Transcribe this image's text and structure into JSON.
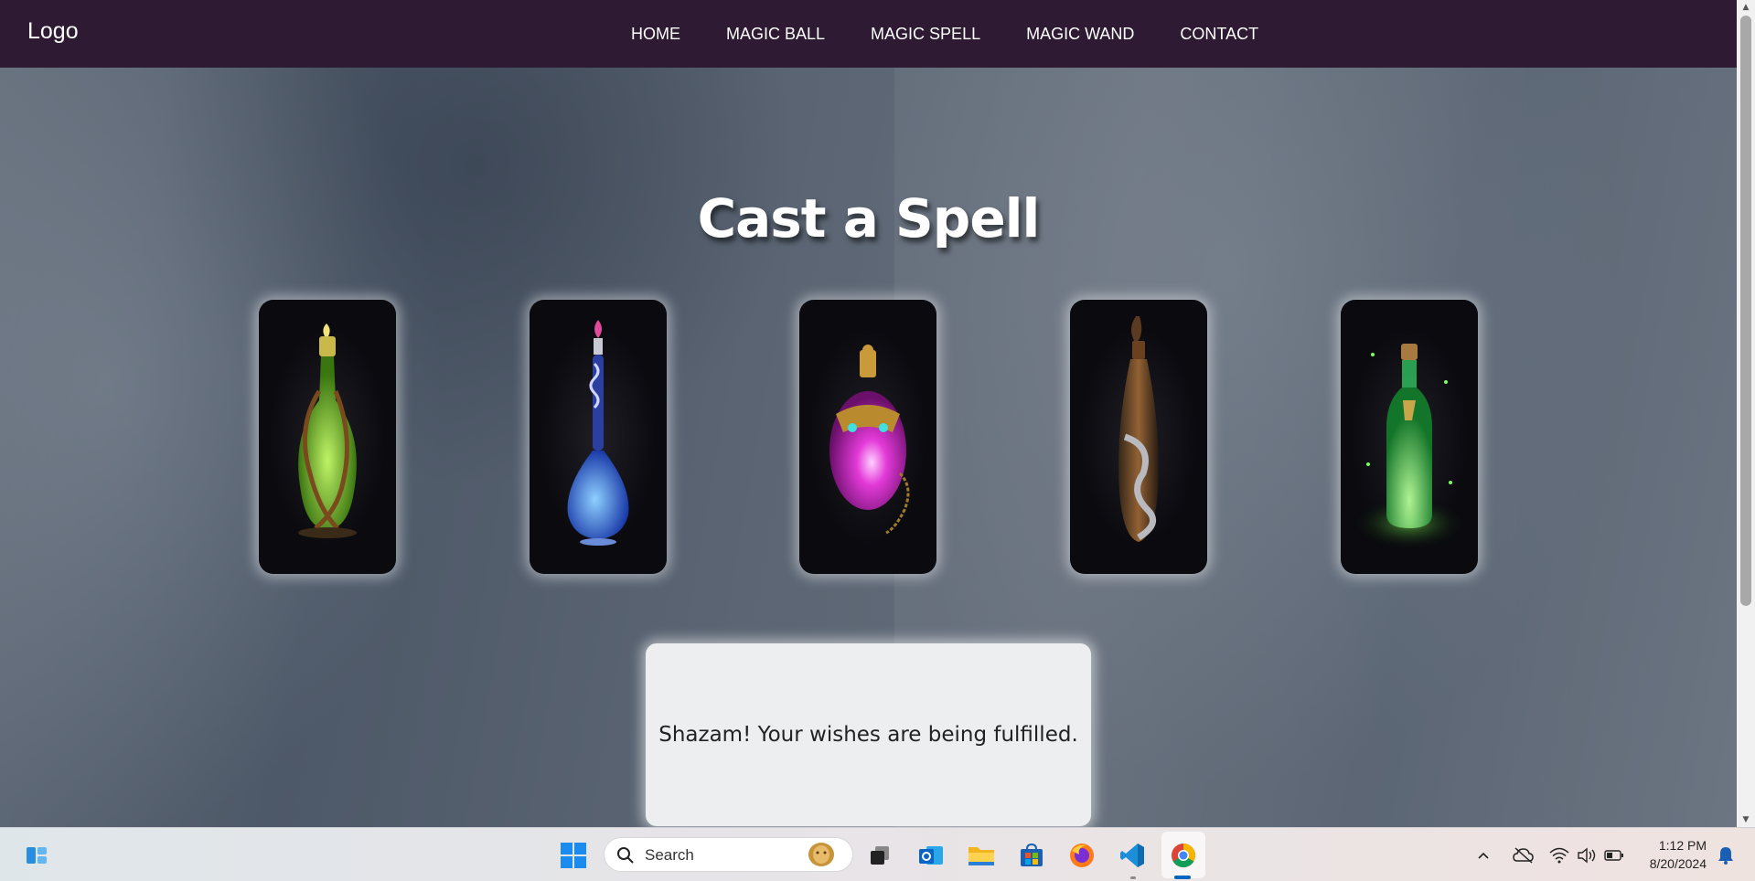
{
  "navbar": {
    "logo": "Logo",
    "links": [
      "HOME",
      "MAGIC BALL",
      "MAGIC SPELL",
      "MAGIC WAND",
      "CONTACT"
    ]
  },
  "main": {
    "title": "Cast a Spell",
    "potions": [
      {
        "name": "green-vine-potion",
        "liquid_color": "#8fe23a"
      },
      {
        "name": "blue-teardrop-potion",
        "liquid_color": "#2f6bff"
      },
      {
        "name": "pink-jeweled-potion",
        "liquid_color": "#e23ad8"
      },
      {
        "name": "serpent-bottle-potion",
        "liquid_color": "#7a4a22"
      },
      {
        "name": "glowing-green-rune-potion",
        "liquid_color": "#3ef06a"
      }
    ],
    "message": "Shazam! Your wishes are being fulfilled."
  },
  "taskbar": {
    "search_placeholder": "Search",
    "apps": [
      "widgets-icon",
      "start-icon",
      "search-icon",
      "task-view-icon",
      "outlook-icon",
      "file-explorer-icon",
      "microsoft-store-icon",
      "firefox-icon",
      "vscode-icon",
      "chrome-icon"
    ],
    "tray": [
      "chevron-up-icon",
      "onedrive-offline-icon",
      "wifi-icon",
      "volume-icon",
      "battery-icon",
      "notification-bell-icon"
    ],
    "time": "1:12 PM",
    "date": "8/20/2024"
  },
  "colors": {
    "navbar": "#2e1a33",
    "accent": "#0067c0"
  }
}
